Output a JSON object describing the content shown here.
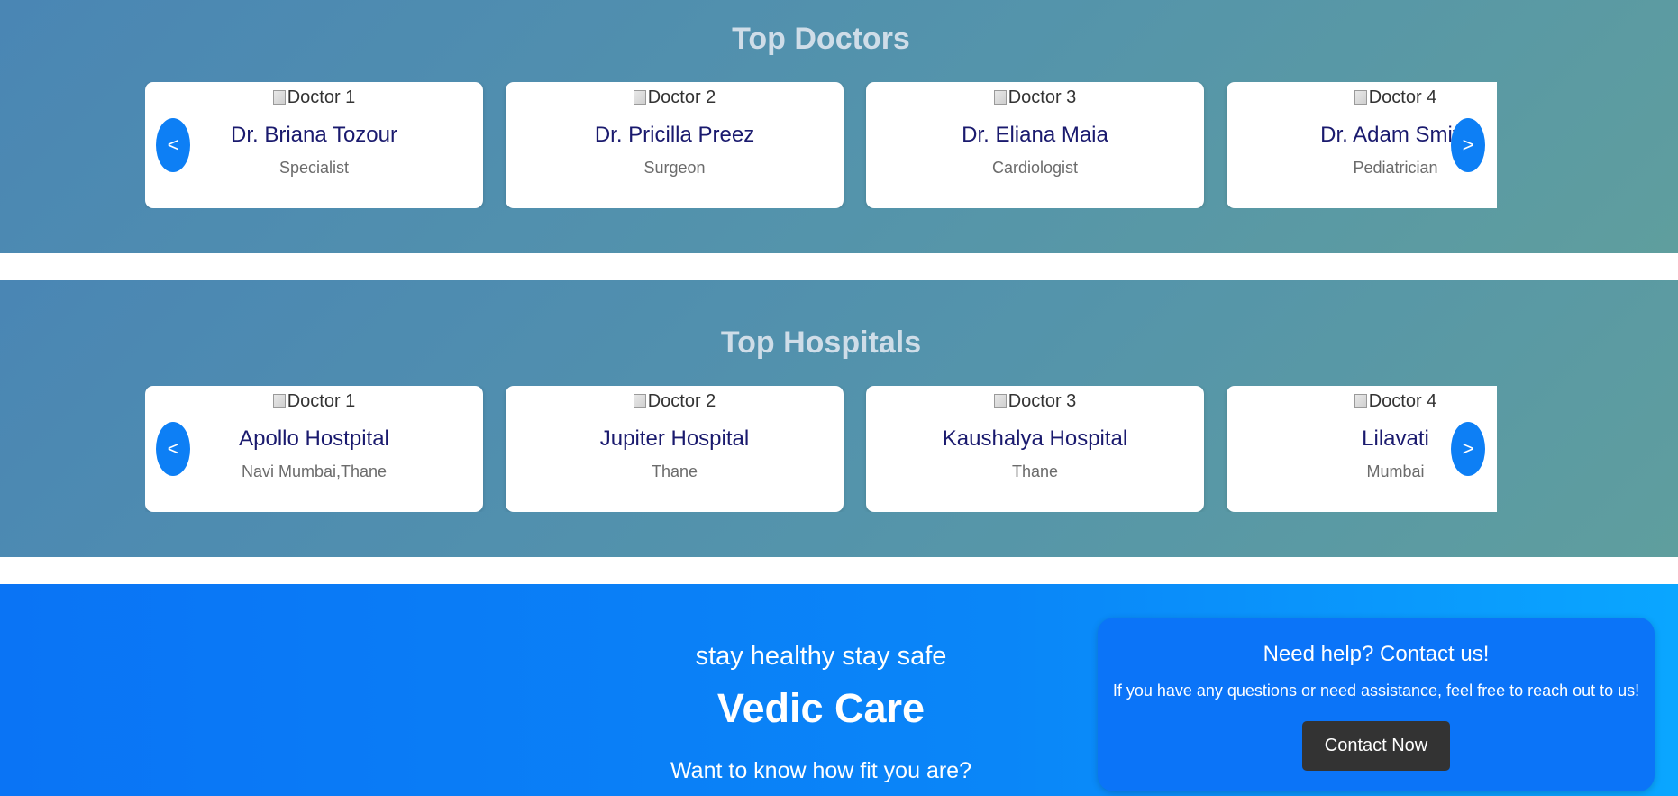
{
  "doctors": {
    "title": "Top Doctors",
    "prev_label": "<",
    "next_label": ">",
    "cards": [
      {
        "image_alt": "Doctor 1",
        "name": "Dr. Briana Tozour",
        "subtitle": "Specialist"
      },
      {
        "image_alt": "Doctor 2",
        "name": "Dr. Pricilla Preez",
        "subtitle": "Surgeon"
      },
      {
        "image_alt": "Doctor 3",
        "name": "Dr. Eliana Maia",
        "subtitle": "Cardiologist"
      },
      {
        "image_alt": "Doctor 4",
        "name": "Dr. Adam Smith",
        "subtitle": "Pediatrician"
      }
    ]
  },
  "hospitals": {
    "title": "Top Hospitals",
    "prev_label": "<",
    "next_label": ">",
    "cards": [
      {
        "image_alt": "Doctor 1",
        "name": "Apollo Hostpital",
        "subtitle": "Navi Mumbai,Thane"
      },
      {
        "image_alt": "Doctor 2",
        "name": "Jupiter Hospital",
        "subtitle": "Thane"
      },
      {
        "image_alt": "Doctor 3",
        "name": "Kaushalya Hospital",
        "subtitle": "Thane"
      },
      {
        "image_alt": "Doctor 4",
        "name": "Lilavati",
        "subtitle": "Mumbai"
      }
    ]
  },
  "footer": {
    "tagline": "stay healthy stay safe",
    "brand": "Vedic Care",
    "fitness_prompt": "Want to know how fit you are?",
    "help": {
      "title": "Need help? Contact us!",
      "text": "If you have any questions or need assistance, feel free to reach out to us!",
      "button_label": "Contact Now"
    }
  },
  "colors": {
    "section_band": "#4a86b4",
    "arrow_button": "#0d7ff5",
    "footer_band": "#0a74f5",
    "contact_button": "#333333",
    "card_name": "#1a1a6e"
  }
}
